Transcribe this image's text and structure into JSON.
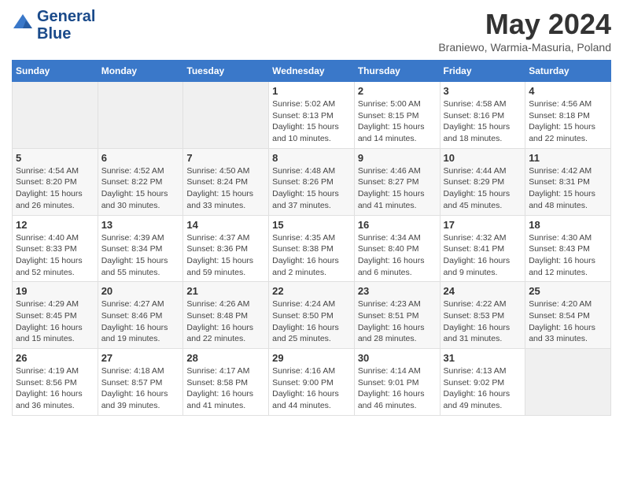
{
  "header": {
    "logo_line1": "General",
    "logo_line2": "Blue",
    "title": "May 2024",
    "subtitle": "Braniewo, Warmia-Masuria, Poland"
  },
  "days_of_week": [
    "Sunday",
    "Monday",
    "Tuesday",
    "Wednesday",
    "Thursday",
    "Friday",
    "Saturday"
  ],
  "weeks": [
    [
      {
        "day": "",
        "info": ""
      },
      {
        "day": "",
        "info": ""
      },
      {
        "day": "",
        "info": ""
      },
      {
        "day": "1",
        "info": "Sunrise: 5:02 AM\nSunset: 8:13 PM\nDaylight: 15 hours\nand 10 minutes."
      },
      {
        "day": "2",
        "info": "Sunrise: 5:00 AM\nSunset: 8:15 PM\nDaylight: 15 hours\nand 14 minutes."
      },
      {
        "day": "3",
        "info": "Sunrise: 4:58 AM\nSunset: 8:16 PM\nDaylight: 15 hours\nand 18 minutes."
      },
      {
        "day": "4",
        "info": "Sunrise: 4:56 AM\nSunset: 8:18 PM\nDaylight: 15 hours\nand 22 minutes."
      }
    ],
    [
      {
        "day": "5",
        "info": "Sunrise: 4:54 AM\nSunset: 8:20 PM\nDaylight: 15 hours\nand 26 minutes."
      },
      {
        "day": "6",
        "info": "Sunrise: 4:52 AM\nSunset: 8:22 PM\nDaylight: 15 hours\nand 30 minutes."
      },
      {
        "day": "7",
        "info": "Sunrise: 4:50 AM\nSunset: 8:24 PM\nDaylight: 15 hours\nand 33 minutes."
      },
      {
        "day": "8",
        "info": "Sunrise: 4:48 AM\nSunset: 8:26 PM\nDaylight: 15 hours\nand 37 minutes."
      },
      {
        "day": "9",
        "info": "Sunrise: 4:46 AM\nSunset: 8:27 PM\nDaylight: 15 hours\nand 41 minutes."
      },
      {
        "day": "10",
        "info": "Sunrise: 4:44 AM\nSunset: 8:29 PM\nDaylight: 15 hours\nand 45 minutes."
      },
      {
        "day": "11",
        "info": "Sunrise: 4:42 AM\nSunset: 8:31 PM\nDaylight: 15 hours\nand 48 minutes."
      }
    ],
    [
      {
        "day": "12",
        "info": "Sunrise: 4:40 AM\nSunset: 8:33 PM\nDaylight: 15 hours\nand 52 minutes."
      },
      {
        "day": "13",
        "info": "Sunrise: 4:39 AM\nSunset: 8:34 PM\nDaylight: 15 hours\nand 55 minutes."
      },
      {
        "day": "14",
        "info": "Sunrise: 4:37 AM\nSunset: 8:36 PM\nDaylight: 15 hours\nand 59 minutes."
      },
      {
        "day": "15",
        "info": "Sunrise: 4:35 AM\nSunset: 8:38 PM\nDaylight: 16 hours\nand 2 minutes."
      },
      {
        "day": "16",
        "info": "Sunrise: 4:34 AM\nSunset: 8:40 PM\nDaylight: 16 hours\nand 6 minutes."
      },
      {
        "day": "17",
        "info": "Sunrise: 4:32 AM\nSunset: 8:41 PM\nDaylight: 16 hours\nand 9 minutes."
      },
      {
        "day": "18",
        "info": "Sunrise: 4:30 AM\nSunset: 8:43 PM\nDaylight: 16 hours\nand 12 minutes."
      }
    ],
    [
      {
        "day": "19",
        "info": "Sunrise: 4:29 AM\nSunset: 8:45 PM\nDaylight: 16 hours\nand 15 minutes."
      },
      {
        "day": "20",
        "info": "Sunrise: 4:27 AM\nSunset: 8:46 PM\nDaylight: 16 hours\nand 19 minutes."
      },
      {
        "day": "21",
        "info": "Sunrise: 4:26 AM\nSunset: 8:48 PM\nDaylight: 16 hours\nand 22 minutes."
      },
      {
        "day": "22",
        "info": "Sunrise: 4:24 AM\nSunset: 8:50 PM\nDaylight: 16 hours\nand 25 minutes."
      },
      {
        "day": "23",
        "info": "Sunrise: 4:23 AM\nSunset: 8:51 PM\nDaylight: 16 hours\nand 28 minutes."
      },
      {
        "day": "24",
        "info": "Sunrise: 4:22 AM\nSunset: 8:53 PM\nDaylight: 16 hours\nand 31 minutes."
      },
      {
        "day": "25",
        "info": "Sunrise: 4:20 AM\nSunset: 8:54 PM\nDaylight: 16 hours\nand 33 minutes."
      }
    ],
    [
      {
        "day": "26",
        "info": "Sunrise: 4:19 AM\nSunset: 8:56 PM\nDaylight: 16 hours\nand 36 minutes."
      },
      {
        "day": "27",
        "info": "Sunrise: 4:18 AM\nSunset: 8:57 PM\nDaylight: 16 hours\nand 39 minutes."
      },
      {
        "day": "28",
        "info": "Sunrise: 4:17 AM\nSunset: 8:58 PM\nDaylight: 16 hours\nand 41 minutes."
      },
      {
        "day": "29",
        "info": "Sunrise: 4:16 AM\nSunset: 9:00 PM\nDaylight: 16 hours\nand 44 minutes."
      },
      {
        "day": "30",
        "info": "Sunrise: 4:14 AM\nSunset: 9:01 PM\nDaylight: 16 hours\nand 46 minutes."
      },
      {
        "day": "31",
        "info": "Sunrise: 4:13 AM\nSunset: 9:02 PM\nDaylight: 16 hours\nand 49 minutes."
      },
      {
        "day": "",
        "info": ""
      }
    ]
  ]
}
